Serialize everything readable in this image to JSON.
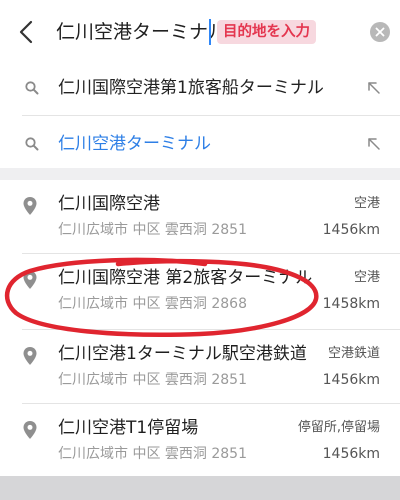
{
  "search": {
    "query": "仁川空港ターミナル",
    "hint": "目的地を入力"
  },
  "suggestions": [
    {
      "text": "仁川国際空港第1旅客船ターミナル",
      "color": "#222222"
    },
    {
      "text": "仁川空港ターミナル",
      "color": "#2e7fe6"
    }
  ],
  "results": [
    {
      "title": "仁川国際空港",
      "address": "仁川広域市 中区 雲西洞 2851",
      "category": "空港",
      "distance": "1456km"
    },
    {
      "title": "仁川国際空港 第2旅客ターミナル",
      "address": "仁川広域市 中区 雲西洞 2868",
      "category": "空港",
      "distance": "1458km"
    },
    {
      "title": "仁川空港1ターミナル駅空港鉄道",
      "address": "仁川広域市 中区 雲西洞 2851",
      "category": "空港鉄道",
      "distance": "1456km"
    },
    {
      "title": "仁川空港T1停留場",
      "address": "仁川広域市 中区 雲西洞 2851",
      "category": "停留所,停留場",
      "distance": "1456km"
    }
  ],
  "colors": {
    "caret": "#2f86f6",
    "hint_background": "#f7d8df",
    "hint_text": "#e4364f",
    "annotation": "#e0252f",
    "suggestion_link": "#2e7fe6"
  },
  "icons": {
    "back": "chevron-left-icon",
    "clear": "clear-icon",
    "suggestion": "search-icon",
    "fill": "arrow-up-left-icon",
    "result": "location-pin-icon"
  }
}
